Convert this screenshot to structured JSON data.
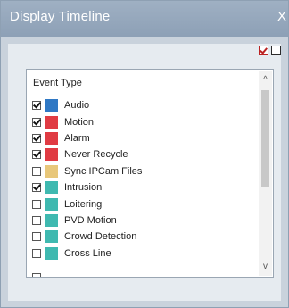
{
  "window": {
    "title": "Display Timeline",
    "close_label": "X"
  },
  "toolbar": {
    "icons": [
      "check-all-icon",
      "uncheck-all-icon"
    ]
  },
  "list": {
    "header": "Event Type",
    "items": [
      {
        "label": "Audio",
        "checked": true,
        "color": "#2f78c4"
      },
      {
        "label": "Motion",
        "checked": true,
        "color": "#e03b43"
      },
      {
        "label": "Alarm",
        "checked": true,
        "color": "#e03b43"
      },
      {
        "label": "Never Recycle",
        "checked": true,
        "color": "#e03b43"
      },
      {
        "label": "Sync IPCam Files",
        "checked": false,
        "color": "#e8c77a"
      },
      {
        "label": "Intrusion",
        "checked": true,
        "color": "#3fb9b0"
      },
      {
        "label": "Loitering",
        "checked": false,
        "color": "#3fb9b0"
      },
      {
        "label": "PVD Motion",
        "checked": false,
        "color": "#3fb9b0"
      },
      {
        "label": "Crowd Detection",
        "checked": false,
        "color": "#3fb9b0"
      },
      {
        "label": "Cross Line",
        "checked": false,
        "color": "#3fb9b0"
      }
    ]
  },
  "scroll": {
    "up_glyph": "^",
    "down_glyph": "v"
  }
}
